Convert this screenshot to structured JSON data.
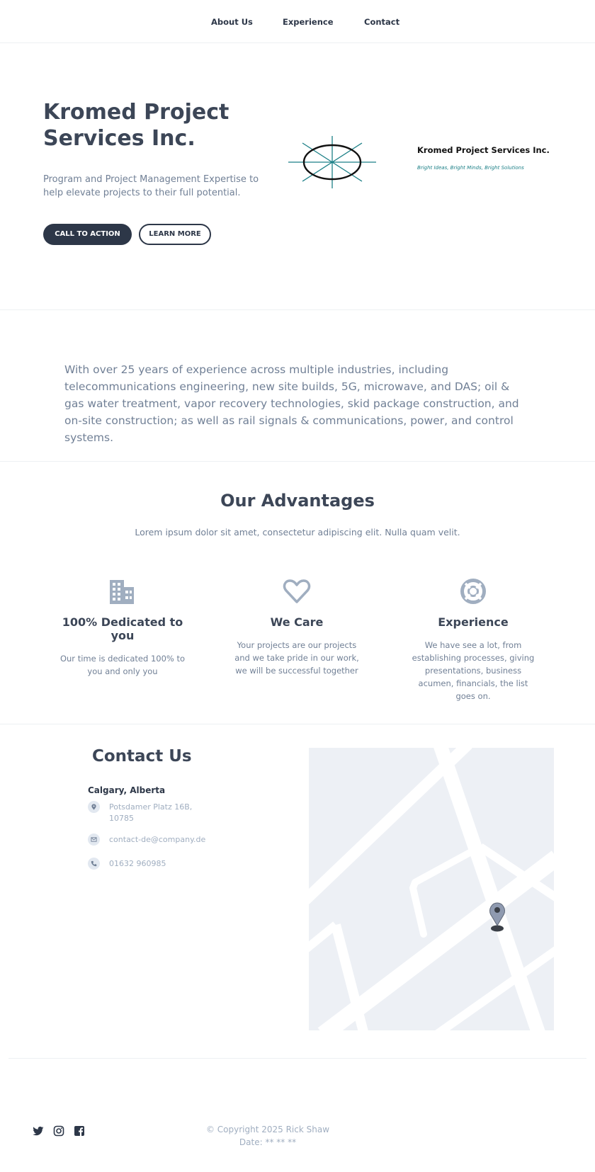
{
  "nav": {
    "items": [
      {
        "label": "About Us"
      },
      {
        "label": "Experience"
      },
      {
        "label": "Contact"
      }
    ]
  },
  "hero": {
    "title": "Kromed Project Services Inc.",
    "subtitle": "Program and Project Management Expertise to help elevate projects to their full potential.",
    "cta_label": "CALL TO ACTION",
    "learn_label": "LEARN MORE",
    "logo_name": "Kromed Project Services Inc.",
    "logo_tagline": "Bright Ideas, Bright Minds, Bright Solutions"
  },
  "experience": {
    "text": "With over 25 years of experience across multiple industries, including telecommunications engineering, new site builds, 5G, microwave, and DAS; oil & gas water treatment, vapor recovery technologies, skid package construction, and on-site construction; as well as rail signals & communications, power, and control systems."
  },
  "advantages": {
    "title": "Our Advantages",
    "subtitle": "Lorem ipsum dolor sit amet, consectetur adipiscing elit. Nulla quam velit.",
    "items": [
      {
        "icon": "building-icon",
        "title": "100% Dedicated to you",
        "text": "Our time is dedicated 100% to you and only you"
      },
      {
        "icon": "heart-icon",
        "title": "We Care",
        "text": "Your projects are our projects and we take pride in our work, we will be successful together"
      },
      {
        "icon": "lifebuoy-icon",
        "title": "Experience",
        "text": "We have see a lot, from establishing processes, giving presentations, business acumen, financials, the list goes on."
      }
    ]
  },
  "contact": {
    "title": "Contact Us",
    "city": "Calgary, Alberta",
    "address": "Potsdamer Platz 16B, 10785",
    "email": "contact-de@company.de",
    "phone": "01632 960985"
  },
  "footer": {
    "social": [
      "twitter-icon",
      "instagram-icon",
      "facebook-icon"
    ],
    "copyright": "© Copyright 2025 Rick Shaw",
    "date": "Date: ** ** **"
  },
  "colors": {
    "primary_dark": "#2d3748",
    "heading": "#3c4657",
    "muted": "#718096",
    "light_muted": "#a0aec0",
    "icon": "#a0aec0",
    "logo_teal": "#1b7f86",
    "map_bg": "#edf0f5"
  }
}
